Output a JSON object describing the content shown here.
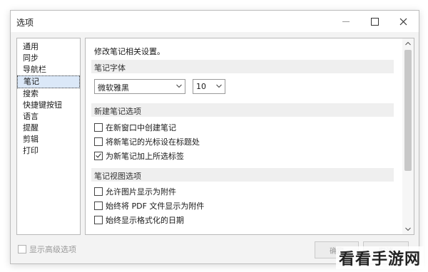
{
  "window": {
    "title": "选项",
    "controls": {
      "minimize": "minimize-icon",
      "maximize": "maximize-icon",
      "close": "close-icon"
    }
  },
  "nav": {
    "items": [
      {
        "label": "通用",
        "active": false
      },
      {
        "label": "同步",
        "active": false
      },
      {
        "label": "导航栏",
        "active": false
      },
      {
        "label": "笔记",
        "active": true
      },
      {
        "label": "搜索",
        "active": false
      },
      {
        "label": "快捷键按钮",
        "active": false
      },
      {
        "label": "语言",
        "active": false
      },
      {
        "label": "提醒",
        "active": false
      },
      {
        "label": "剪辑",
        "active": false
      },
      {
        "label": "打印",
        "active": false
      }
    ]
  },
  "content": {
    "description": "修改笔记相关设置。",
    "font_section": {
      "title": "笔记字体",
      "font_family": "微软雅黑",
      "font_size": "10"
    },
    "new_note_section": {
      "title": "新建笔记选项",
      "options": [
        {
          "label": "在新窗口中创建笔记",
          "checked": false
        },
        {
          "label": "将新笔记的光标设在标题处",
          "checked": false
        },
        {
          "label": "为新笔记加上所选标签",
          "checked": true
        }
      ]
    },
    "view_section": {
      "title": "笔记视图选项",
      "options": [
        {
          "label": "允许图片显示为附件",
          "checked": false
        },
        {
          "label": "始终将 PDF 文件显示为附件",
          "checked": false
        },
        {
          "label": "始终显示格式化的日期",
          "checked": false
        }
      ]
    }
  },
  "footer": {
    "advanced_label": "显示高级选项",
    "advanced_checked": false,
    "ok_label": "确定",
    "cancel_label": "取消"
  },
  "watermark": "看看手游网"
}
